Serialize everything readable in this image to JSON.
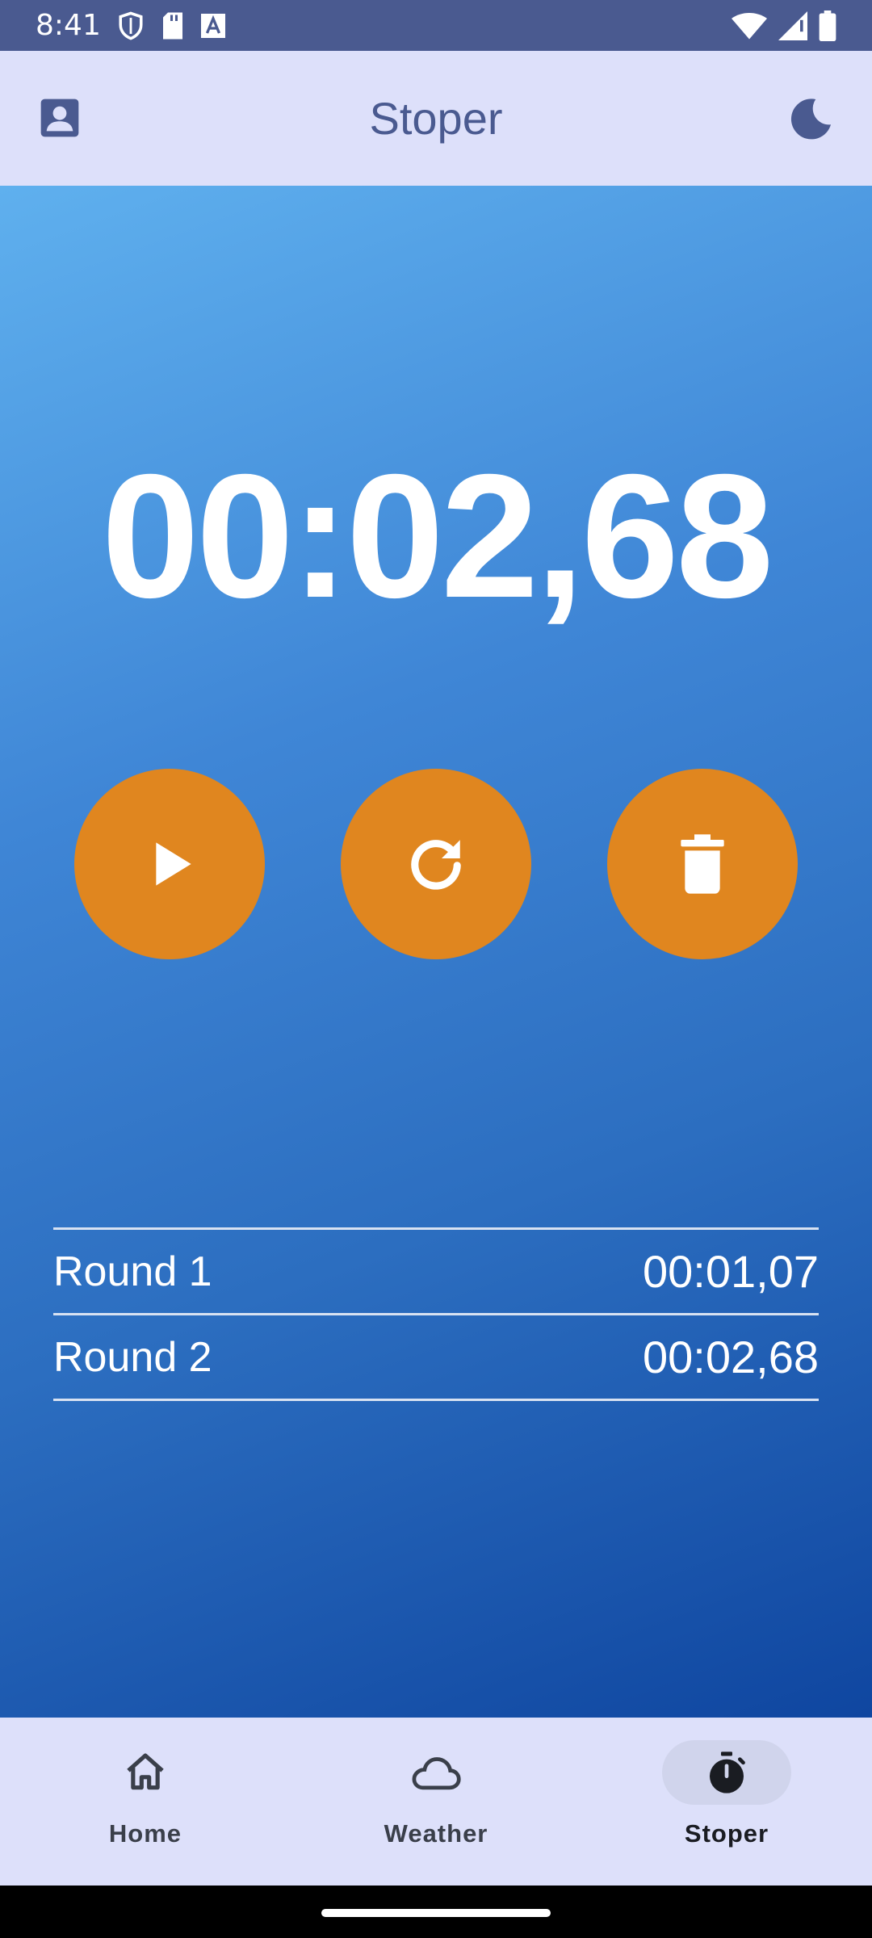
{
  "status_bar": {
    "time": "8:41",
    "left_icons": [
      "shield-icon",
      "sd-card-icon",
      "text-a-icon"
    ],
    "right_icons": [
      "wifi-icon",
      "signal-icon",
      "battery-icon"
    ]
  },
  "app_bar": {
    "title": "Stoper",
    "left_icon": "profile-icon",
    "right_icon": "dark-mode-moon-icon",
    "background": "#dde0fa",
    "title_color": "#4a5a90"
  },
  "stopwatch": {
    "time": "00:02,68",
    "controls": [
      {
        "name": "play",
        "icon": "play-icon"
      },
      {
        "name": "reset",
        "icon": "refresh-icon"
      },
      {
        "name": "delete",
        "icon": "trash-icon"
      }
    ],
    "accent": "#e0861f"
  },
  "rounds": [
    {
      "label": "Round 1",
      "time": "00:01,07"
    },
    {
      "label": "Round 2",
      "time": "00:02,68"
    }
  ],
  "bottom_nav": {
    "items": [
      {
        "label": "Home",
        "icon": "home-icon",
        "active": false
      },
      {
        "label": "Weather",
        "icon": "cloud-icon",
        "active": false
      },
      {
        "label": "Stoper",
        "icon": "stopwatch-icon",
        "active": true
      }
    ]
  }
}
